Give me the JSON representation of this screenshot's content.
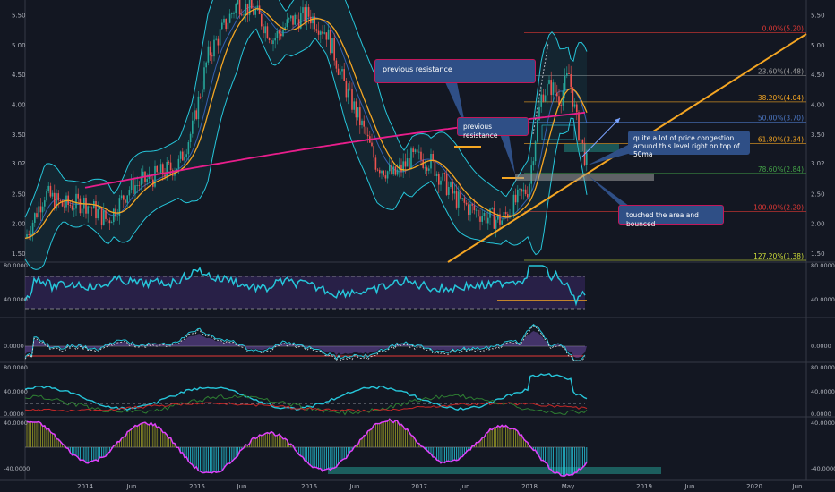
{
  "chart_data": [
    {
      "type": "line",
      "panel": "price",
      "x_axis": {
        "tick_labels": [
          "2014",
          "Jun",
          "2015",
          "Jun",
          "2016",
          "Jun",
          "2017",
          "Jun",
          "2018",
          "May",
          "2019",
          "Jun",
          "2020",
          "Jun"
        ]
      },
      "y_axis": {
        "ticks": [
          "5.50",
          "5.00",
          "4.50",
          "4.00",
          "3.50",
          "3.02",
          "2.50",
          "2.00",
          "1.50"
        ],
        "ylim": [
          1.35,
          5.75
        ]
      },
      "current_price_label": "3.02",
      "fibonacci_levels": [
        {
          "label": "0.00%(5.20)",
          "value": 5.2,
          "color": "#e53935"
        },
        {
          "label": "23.60%(4.48)",
          "value": 4.48,
          "color": "#9e9e9e"
        },
        {
          "label": "38.20%(4.04)",
          "value": 4.04,
          "color": "#f5a623"
        },
        {
          "label": "50.00%(3.70)",
          "value": 3.7,
          "color": "#4d79c7"
        },
        {
          "label": "61.80%(3.34)",
          "value": 3.34,
          "color": "#f5a623"
        },
        {
          "label": "78.60%(2.84)",
          "value": 2.84,
          "color": "#43a047"
        },
        {
          "label": "100.00%(2.20)",
          "value": 2.2,
          "color": "#e53935"
        },
        {
          "label": "127.20%(1.38)",
          "value": 1.38,
          "color": "#cddc39"
        }
      ],
      "annotations": [
        {
          "text": "previous resistance"
        },
        {
          "text": "previous resistance"
        },
        {
          "text": "quite a lot of price congestion around this level right on top of 50ma"
        },
        {
          "text": "touched the area and bounced"
        }
      ],
      "series": [
        {
          "name": "",
          "color": "#f5a623",
          "kind": "ma50"
        },
        {
          "name": "",
          "color": "#e91e8c",
          "kind": "ma200"
        },
        {
          "name": "",
          "color": "#26c6da",
          "kind": "bollinger"
        }
      ]
    },
    {
      "type": "line",
      "panel": "rsi",
      "y_axis": {
        "ticks": [
          "80.0000",
          "40.0000"
        ]
      },
      "color": "#26c6da"
    },
    {
      "type": "line",
      "panel": "macd",
      "y_axis": {
        "ticks": [
          "0.0000"
        ]
      }
    },
    {
      "type": "line",
      "panel": "dmi",
      "y_axis": {
        "ticks": [
          "80.0000",
          "40.0000",
          "0.0000"
        ]
      }
    },
    {
      "type": "bar",
      "panel": "oscillator",
      "y_axis": {
        "ticks": [
          "40.0000",
          "-40.0000"
        ]
      }
    }
  ],
  "colors": {
    "background": "#131722",
    "axis_text": "#b2b5be",
    "ma50": "#f5a623",
    "ma200": "#e91e8c",
    "bollinger": "#26c6da",
    "trendline": "#f5a623",
    "candle_up": "#26a69a",
    "candle_down": "#ef5350",
    "annotation_bg": "#2f4f86"
  }
}
